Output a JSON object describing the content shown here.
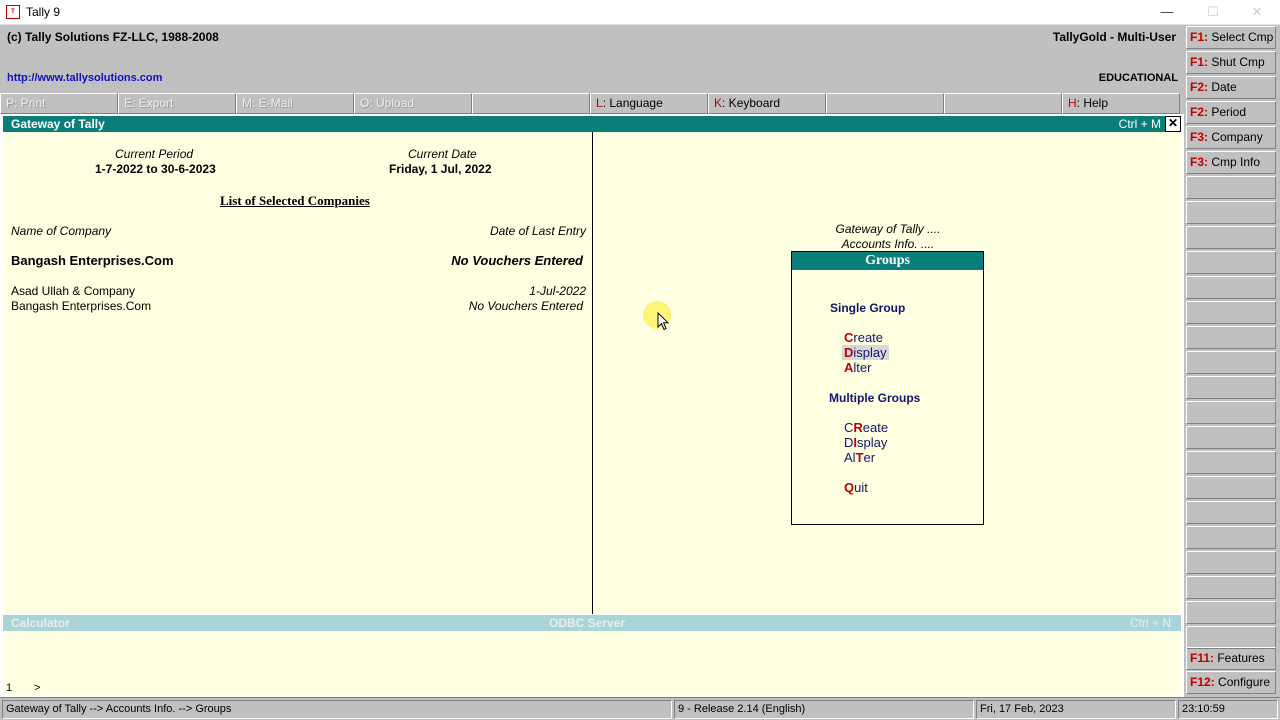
{
  "window": {
    "title": "Tally 9"
  },
  "header": {
    "copyright": "(c) Tally Solutions FZ-LLC, 1988-2008",
    "product": "TallyGold - Multi-User",
    "url": "http://www.tallysolutions.com",
    "edition": "EDUCATIONAL"
  },
  "top_menu": [
    {
      "key": "P",
      "label": ": Print",
      "enabled": false
    },
    {
      "key": "E",
      "label": ": Export",
      "enabled": false
    },
    {
      "key": "M",
      "label": ": E-Mail",
      "enabled": false
    },
    {
      "key": "O",
      "label": ": Upload",
      "enabled": false
    },
    {
      "key": "",
      "label": "",
      "enabled": false
    },
    {
      "key": "L",
      "label": ": Language",
      "enabled": true
    },
    {
      "key": "K",
      "label": ": Keyboard",
      "enabled": true
    },
    {
      "key": "",
      "label": "",
      "enabled": false
    },
    {
      "key": "",
      "label": "",
      "enabled": false
    },
    {
      "key": "H",
      "label": ": Help",
      "enabled": true
    }
  ],
  "gateway_bar": {
    "title": "Gateway of Tally",
    "shortcut": "Ctrl + M",
    "close": "✕"
  },
  "left_panel": {
    "current_period_label": "Current Period",
    "current_period_value": "1-7-2022 to 30-6-2023",
    "current_date_label": "Current Date",
    "current_date_value": "Friday, 1 Jul, 2022",
    "list_title": "List of Selected Companies",
    "col_company": "Name of Company",
    "col_last_entry": "Date of Last Entry",
    "active_company": {
      "name": "Bangash Enterprises.Com",
      "last_entry": "No Vouchers Entered"
    },
    "companies": [
      {
        "name": "Asad Ullah & Company",
        "last_entry": "1-Jul-2022"
      },
      {
        "name": "Bangash Enterprises.Com",
        "last_entry": "No Vouchers Entered"
      }
    ]
  },
  "right_panel": {
    "breadcrumb_1": "Gateway of Tally ....",
    "breadcrumb_2": "Accounts Info. ....",
    "menu": {
      "title": "Groups",
      "single_section": "Single Group",
      "single_items": [
        {
          "hotkey": "C",
          "rest": "reate",
          "pre": ""
        },
        {
          "hotkey": "D",
          "rest": "isplay",
          "pre": ""
        },
        {
          "hotkey": "A",
          "rest": "lter",
          "pre": ""
        }
      ],
      "multiple_section": "Multiple Groups",
      "multiple_items": [
        {
          "pre": "C",
          "hotkey": "R",
          "rest": "eate"
        },
        {
          "pre": "D",
          "hotkey": "I",
          "rest": "splay"
        },
        {
          "pre": "Al",
          "hotkey": "T",
          "rest": "er"
        }
      ],
      "quit": {
        "hotkey": "Q",
        "rest": "uit"
      }
    }
  },
  "calc_bar": {
    "calculator": "Calculator",
    "odbc": "ODBC Server",
    "shortcut": "Ctrl + N"
  },
  "calc_area": {
    "line": "1",
    "prompt": ">"
  },
  "status_bar": {
    "path": "Gateway of Tally --> Accounts Info. --> Groups",
    "release": "9 - Release 2.14 (English)",
    "date": "Fri, 17 Feb, 2023",
    "time": "23:10:59"
  },
  "right_buttons": [
    {
      "key": "F1:",
      "label": " Select Cmp"
    },
    {
      "key": "F1:",
      "label": " Shut Cmp"
    },
    {
      "key": "F2:",
      "label": " Date"
    },
    {
      "key": "F2:",
      "label": " Period"
    },
    {
      "key": "F3:",
      "label": " Company"
    },
    {
      "key": "F3:",
      "label": " Cmp Info"
    }
  ],
  "right_buttons_bottom": [
    {
      "key": "F11:",
      "label": " Features"
    },
    {
      "key": "F12:",
      "label": " Configure"
    }
  ]
}
